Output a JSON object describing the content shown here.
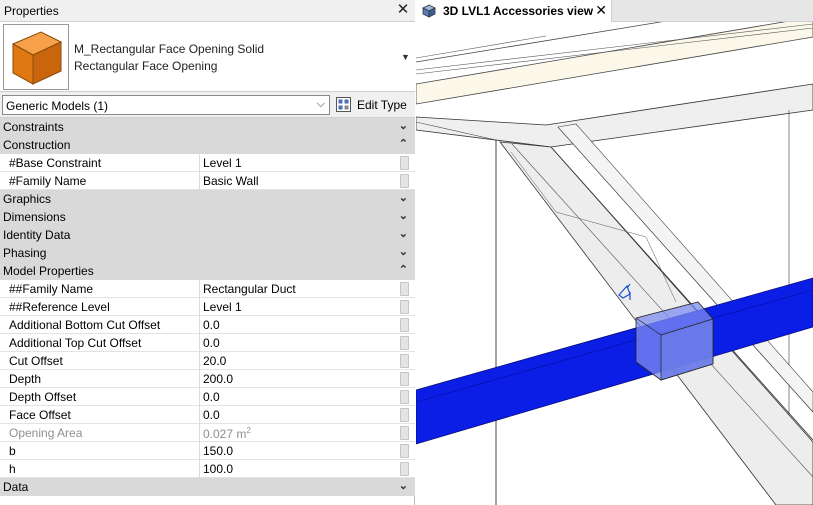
{
  "palette": {
    "title": "Properties",
    "type_selector": {
      "family": "M_Rectangular Face Opening Solid",
      "type": "Rectangular Face Opening",
      "thumbnail_color": "#f08a1c"
    },
    "filter": {
      "value": "Generic Models (1)"
    },
    "edit_type_label": "Edit Type"
  },
  "groups": [
    {
      "name": "Constraints",
      "state": "collapsed",
      "params": []
    },
    {
      "name": "Construction",
      "state": "expanded",
      "params": [
        {
          "name": "#Base Constraint",
          "value": "Level 1"
        },
        {
          "name": "#Family Name",
          "value": "Basic Wall"
        }
      ]
    },
    {
      "name": "Graphics",
      "state": "collapsed",
      "params": []
    },
    {
      "name": "Dimensions",
      "state": "collapsed",
      "params": []
    },
    {
      "name": "Identity Data",
      "state": "collapsed",
      "params": []
    },
    {
      "name": "Phasing",
      "state": "collapsed",
      "params": []
    },
    {
      "name": "Model Properties",
      "state": "expanded",
      "params": [
        {
          "name": "##Family Name",
          "value": "Rectangular Duct"
        },
        {
          "name": "##Reference Level",
          "value": "Level 1"
        },
        {
          "name": "Additional Bottom Cut Offset",
          "value": "0.0"
        },
        {
          "name": "Additional Top Cut Offset",
          "value": "0.0"
        },
        {
          "name": "Cut Offset",
          "value": "20.0"
        },
        {
          "name": "Depth",
          "value": "200.0"
        },
        {
          "name": "Depth Offset",
          "value": "0.0"
        },
        {
          "name": "Face Offset",
          "value": "0.0"
        },
        {
          "name": "Opening Area",
          "value": "0.027 m",
          "unit_sup": "2",
          "disabled": true
        },
        {
          "name": "b",
          "value": "150.0"
        },
        {
          "name": "h",
          "value": "100.0"
        }
      ]
    },
    {
      "name": "Data",
      "state": "collapsed",
      "params": []
    }
  ],
  "view": {
    "tab_title": "3D LVL1 Accessories view",
    "duct_color": "#0a1ee6",
    "opening_color": "#7d8cf0",
    "floor_color": "#fbf8ea"
  }
}
